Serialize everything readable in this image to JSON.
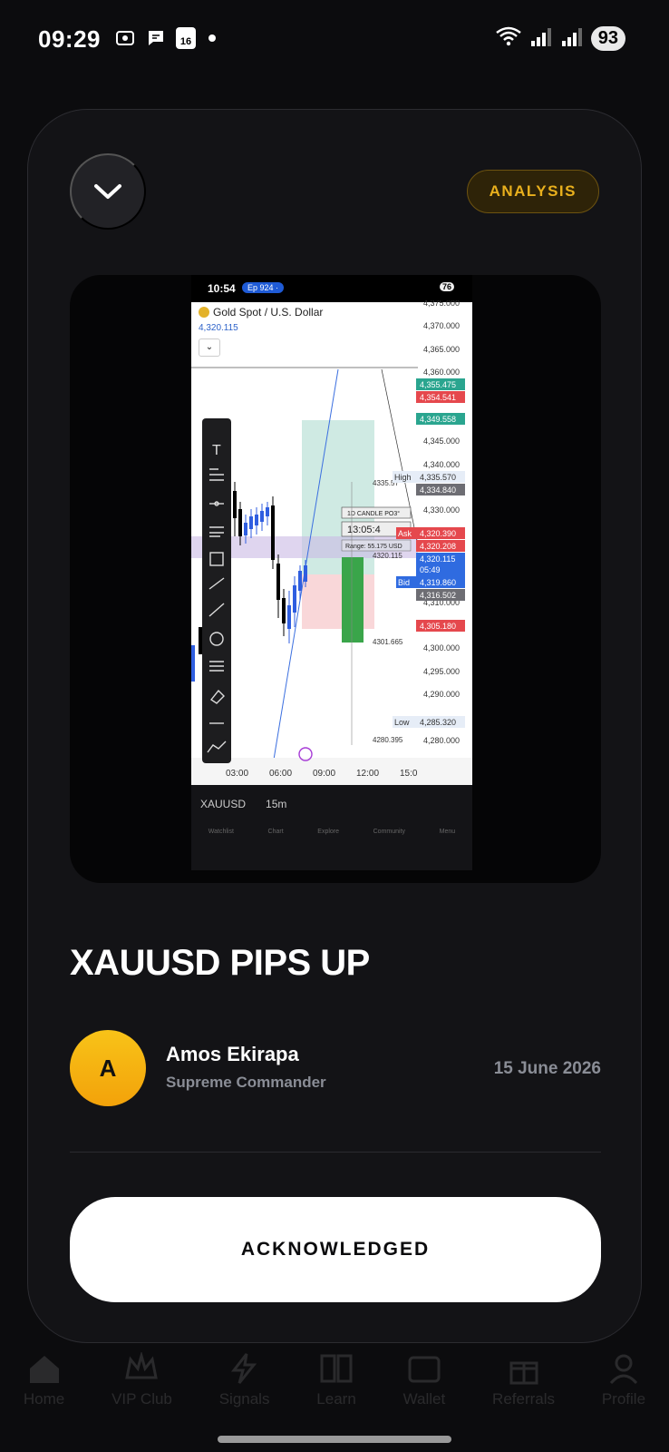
{
  "status_bar": {
    "time": "09:29",
    "calendar_day": "16",
    "battery": "93"
  },
  "background_nav": {
    "items": [
      "Home",
      "VIP Club",
      "Signals",
      "Learn",
      "Wallet",
      "Referrals",
      "Profile"
    ]
  },
  "modal": {
    "badge": "ANALYSIS",
    "close_icon": "chevron-down-icon",
    "title": "XAUUSD PIPS UP",
    "author": {
      "initial": "A",
      "name": "Amos Ekirapa",
      "role": "Supreme Commander"
    },
    "date": "15 June 2026",
    "acknowledge_label": "ACKNOWLEDGED"
  },
  "embedded_screenshot": {
    "time": "10:54",
    "pill": "Ep 924 ·",
    "battery": "76",
    "symbol_title": "Gold Spot / U.S. Dollar",
    "price": "4,320.115",
    "axis_prices": [
      "4,375.000",
      "4,370.000",
      "4,365.000",
      "4,360.000",
      "4,345.000",
      "4,340.000",
      "4,330.000",
      "4,310.000",
      "4,300.000",
      "4,295.000",
      "4,290.000",
      "4,280.000"
    ],
    "labels": {
      "p1": "4,355.475",
      "p2": "4,354.541",
      "p3": "4,349.558",
      "high_label": "High",
      "high": "4,335.570",
      "p4": "4,334.840",
      "ask_label": "Ask",
      "ask": "4,320.390",
      "p5": "4,320.208",
      "cur": "4,320.115",
      "cur_time": "05:49",
      "bid_label": "Bid",
      "bid": "4,319.860",
      "p6": "4,316.502",
      "p7": "4,305.180",
      "low_label": "Low",
      "low": "4,285.320"
    },
    "annotations": {
      "candle": "1D CANDLE PO3°",
      "timer": "13:05:4",
      "range": "Range: 55.175 USD",
      "level_high": "4335.57",
      "level_mid": "4320.115",
      "level_low": "4301.665",
      "level_bottom": "4280.395"
    },
    "time_axis": [
      "03:00",
      "06:00",
      "09:00",
      "12:00",
      "15:0"
    ],
    "bottom": {
      "symbol": "XAUUSD",
      "interval": "15m",
      "tabs": [
        "Watchlist",
        "Chart",
        "Explore",
        "Community",
        "Menu"
      ]
    }
  }
}
